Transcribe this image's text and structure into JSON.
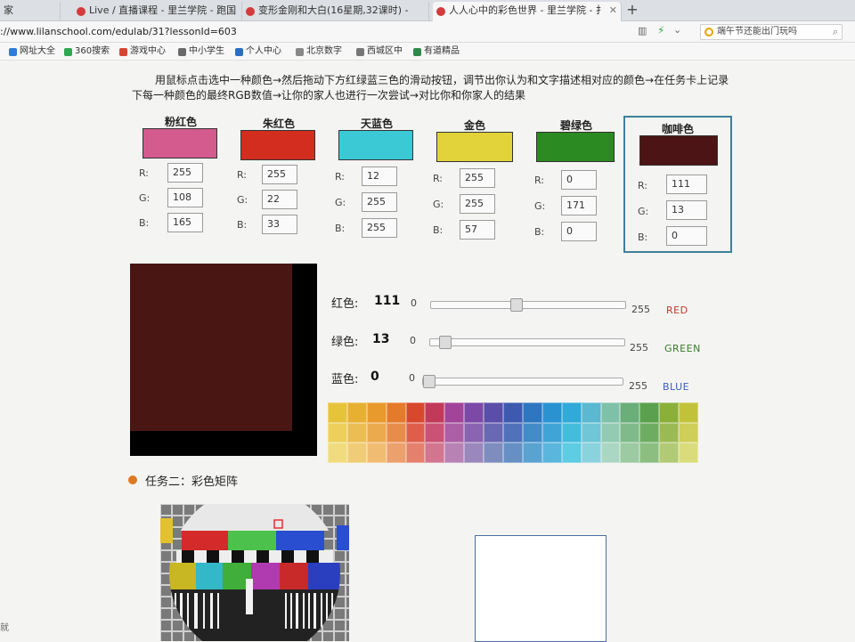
{
  "browser": {
    "tabs": [
      {
        "label": "家"
      },
      {
        "label": "Live / 直播课程 - 里兰学院 - 跑国"
      },
      {
        "label": "变形金刚和大白(16星期,32课时) -"
      },
      {
        "label": "人人心中的彩色世界 - 里兰学院 - 扌"
      }
    ],
    "new_tab": "+",
    "url": "://www.lilanschool.com/edulab/31?lessonId=603",
    "search_text": "端午节还能出门玩吗",
    "bookmarks": [
      {
        "label": "网址大全",
        "color": "#2f7bd8"
      },
      {
        "label": "360搜索",
        "color": "#2fa84f"
      },
      {
        "label": "游戏中心",
        "color": "#d8442f"
      },
      {
        "label": "中小学生",
        "color": "#6a6a6a"
      },
      {
        "label": "个人中心",
        "color": "#2a6fbf"
      },
      {
        "label": "北京数字",
        "color": "#888888"
      },
      {
        "label": "西城区中",
        "color": "#777777"
      },
      {
        "label": "有道精品",
        "color": "#2f8a4a"
      }
    ]
  },
  "lesson": {
    "instruction": "用鼠标点击选中一种颜色→然后拖动下方红绿蓝三色的滑动按钮，调节出你认为和文字描述相对应的颜色→在任务卡上记录下每一种颜色的最终RGB数值→让你的家人也进行一次尝试→对比你和你家人的结果",
    "labels": {
      "r": "R:",
      "g": "G:",
      "b": "B:"
    },
    "cards": [
      {
        "name": "粉红色",
        "r": "255",
        "g": "108",
        "b": "165",
        "color": "#d35b8e"
      },
      {
        "name": "朱红色",
        "r": "255",
        "g": "22",
        "b": "33",
        "color": "#d22d1f"
      },
      {
        "name": "天蓝色",
        "r": "12",
        "g": "255",
        "b": "255",
        "color": "#3cc9d6"
      },
      {
        "name": "金色",
        "r": "255",
        "g": "255",
        "b": "57",
        "color": "#e2d33a"
      },
      {
        "name": "碧绿色",
        "r": "0",
        "g": "171",
        "b": "0",
        "color": "#2b8a21"
      },
      {
        "name": "咖啡色",
        "r": "111",
        "g": "13",
        "b": "0",
        "color": "#4c1414",
        "selected": true
      }
    ],
    "preview_color": "#4a1613",
    "sliders": [
      {
        "label": "红色:",
        "value": "111",
        "min": "0",
        "max": "255",
        "name": "RED",
        "color": "#c0392b",
        "fraction": 0.435
      },
      {
        "label": "绿色:",
        "value": "13",
        "min": "0",
        "max": "255",
        "name": "GREEN",
        "color": "#3a7a2a",
        "fraction": 0.05
      },
      {
        "label": "蓝色:",
        "value": "0",
        "min": "0",
        "max": "255",
        "name": "BLUE",
        "color": "#3a5fc0",
        "fraction": 0.0
      }
    ],
    "palette": [
      "#e6c43a",
      "#e8b032",
      "#e89a2c",
      "#e47a2a",
      "#d8482c",
      "#c23a5a",
      "#a2449a",
      "#7c4aa6",
      "#5a4ea8",
      "#3e5ab0",
      "#2e76c0",
      "#2a92d0",
      "#30aad8",
      "#5ab8d0",
      "#7ec0a8",
      "#6aae7a",
      "#5aa04e",
      "#8ab03a",
      "#c2c23a",
      "#ecd05a",
      "#ecbd52",
      "#ecaa4e",
      "#e88c4a",
      "#de5e4a",
      "#ca5274",
      "#ac5ea6",
      "#8a64b0",
      "#6a68b2",
      "#5072ba",
      "#428cc8",
      "#40a4d6",
      "#44bcdc",
      "#6ec6d6",
      "#92cab4",
      "#80ba8a",
      "#6eac62",
      "#9cba54",
      "#cece58",
      "#f0dc7e",
      "#f0cc76",
      "#f0bc72",
      "#eca06e",
      "#e4806c",
      "#d27690",
      "#b882b4",
      "#9a88bc",
      "#7e8cbe",
      "#6690c4",
      "#5aa2d0",
      "#5ab6dc",
      "#5ecce2",
      "#8ad2de",
      "#aad6c4",
      "#9ccaa2",
      "#8cbe82",
      "#b2ca76",
      "#dadc7c"
    ],
    "task2": "任务二：彩色矩阵",
    "status_left": "就"
  }
}
